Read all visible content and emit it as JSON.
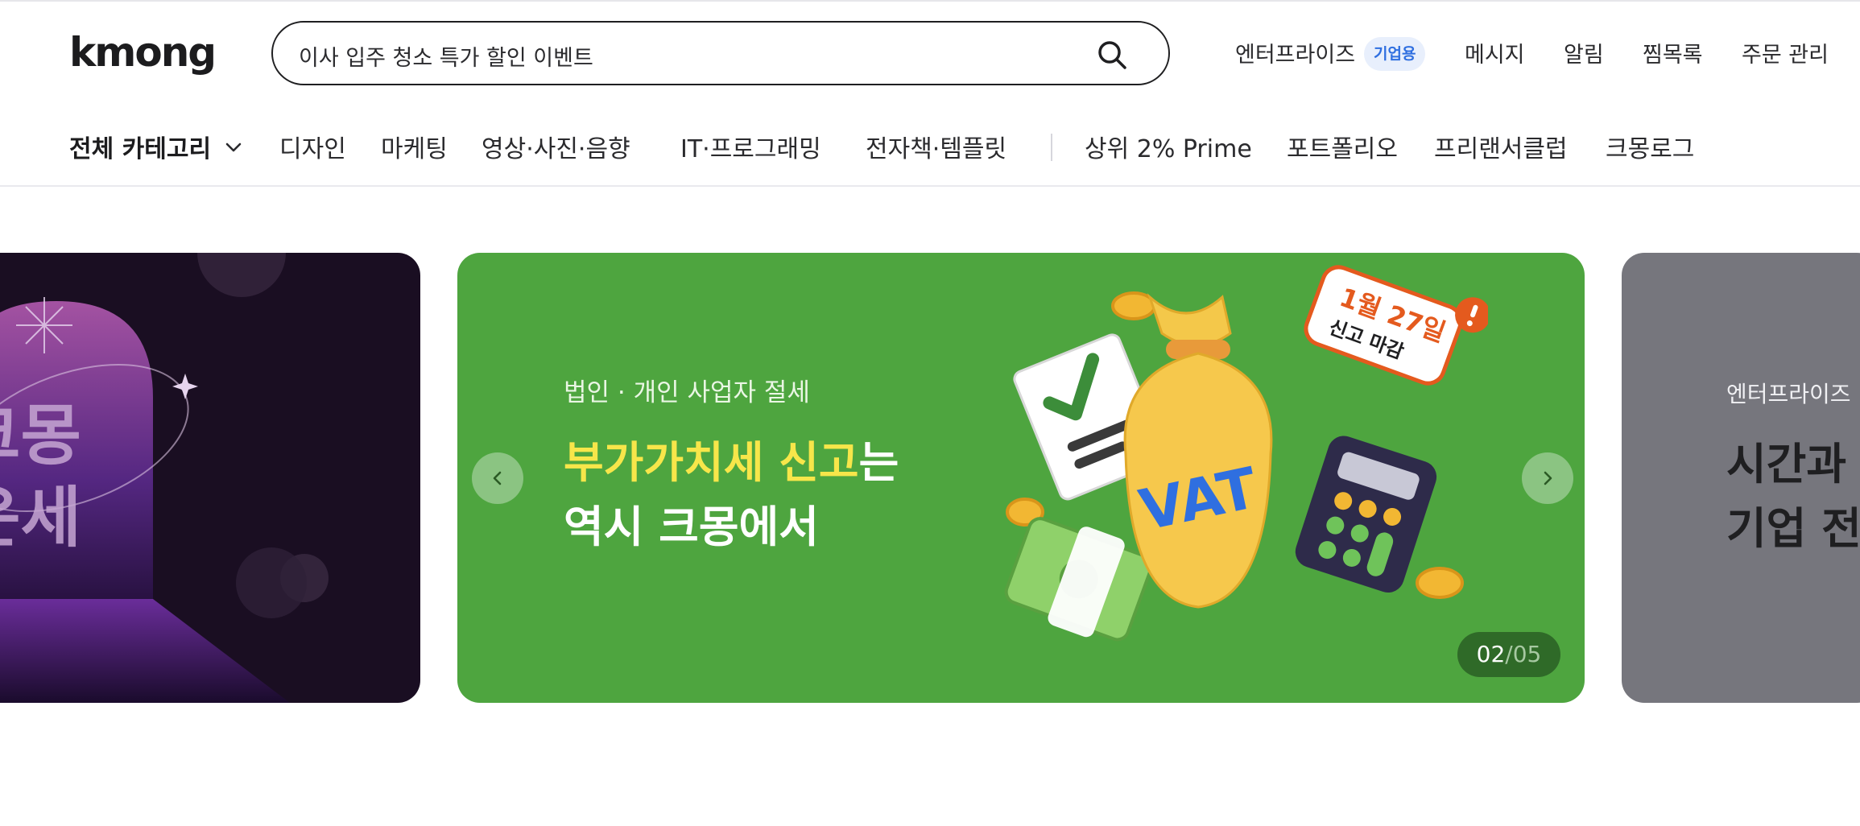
{
  "header": {
    "logo": "kmong",
    "search": {
      "value": "이사 입주 청소 특가 할인 이벤트"
    },
    "links": {
      "enterprise": "엔터프라이즈",
      "enterprise_badge": "기업용",
      "messages": "메시지",
      "notifications": "알림",
      "wishlist": "찜목록",
      "orders": "주문 관리"
    }
  },
  "nav": {
    "all_categories": "전체 카테고리",
    "items": [
      "디자인",
      "마케팅",
      "영상·사진·음향",
      "IT·프로그래밍",
      "전자책·템플릿",
      "상위 2% Prime",
      "포트폴리오",
      "프리랜서클럽",
      "크몽로그"
    ]
  },
  "banners": {
    "left": {
      "line1": "크몽",
      "line2": "운세"
    },
    "main": {
      "subtitle": "법인 · 개인 사업자 절세",
      "title_highlight": "부가가치세 신고",
      "title_suffix": "는",
      "title_line2": "역시 크몽에서",
      "sticker_date": "1월 27일",
      "sticker_note": "신고 마감",
      "bag_text": "VAT",
      "counter_current": "02",
      "counter_separator": "/",
      "counter_total": "05"
    },
    "right": {
      "subtitle": "엔터프라이즈",
      "line1": "시간과",
      "line2": "기업 전"
    }
  },
  "colors": {
    "main_banner_bg": "#4ea53f",
    "highlight": "#f7e64a",
    "badge_text": "#2f6fe0",
    "right_banner_bg": "#76767d",
    "left_banner_bg": "#1a0e22"
  },
  "icons": {
    "search": "search-icon",
    "chevron": "chevron-down-icon",
    "prev": "chevron-left-icon",
    "next": "chevron-right-icon"
  }
}
